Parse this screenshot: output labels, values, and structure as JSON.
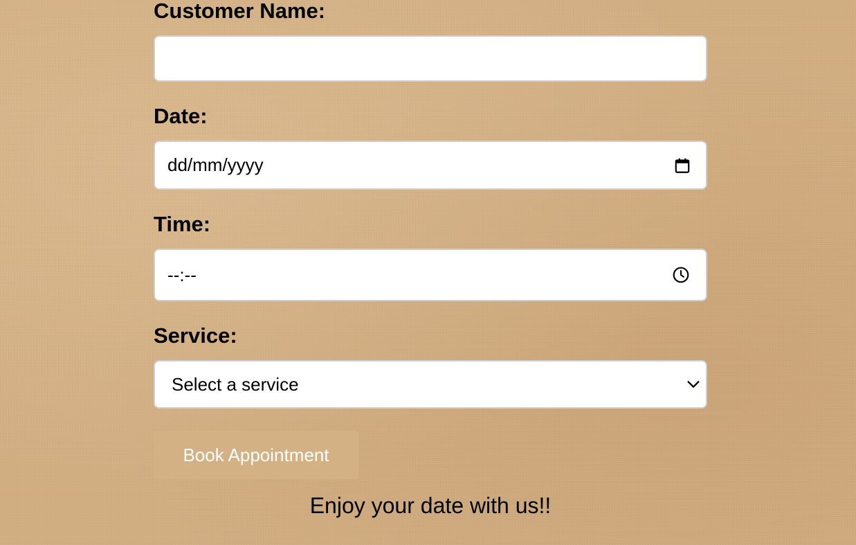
{
  "form": {
    "customer_name": {
      "label": "Customer Name:",
      "value": ""
    },
    "date": {
      "label": "Date:",
      "placeholder": "dd/mm/yyyy",
      "icon": "calendar-icon"
    },
    "time": {
      "label": "Time:",
      "placeholder": "--:--",
      "icon": "clock-icon"
    },
    "service": {
      "label": "Service:",
      "selected": "Select a service",
      "icon": "chevron-down-icon"
    },
    "submit_label": "Book Appointment",
    "tagline": "Enjoy your date with us!!"
  },
  "colors": {
    "background": "#d1ad82",
    "button": "#d4b185",
    "button_text": "#ffffff",
    "field_border": "#cfcfcf"
  }
}
